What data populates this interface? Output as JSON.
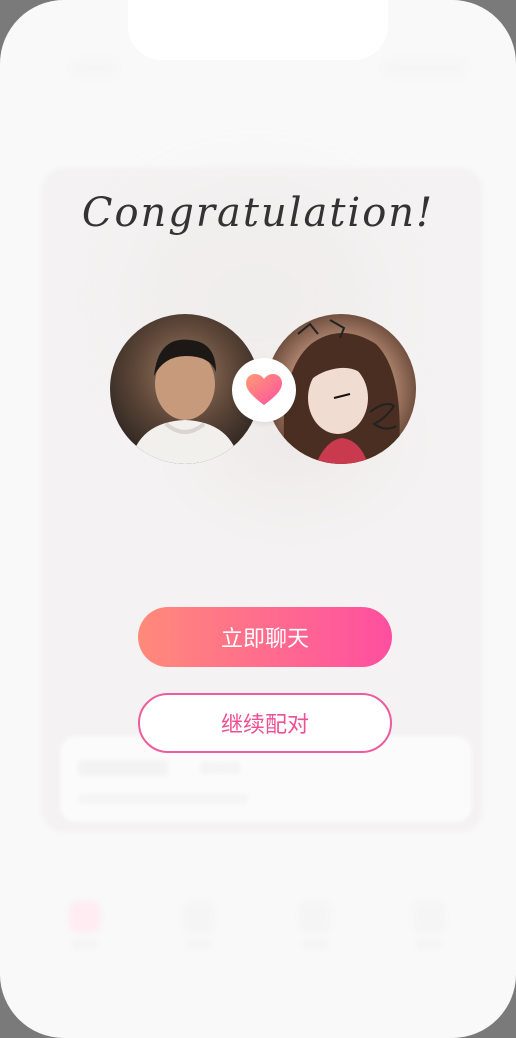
{
  "modal": {
    "title": "Congratulation!",
    "chat_button_label": "立即聊天",
    "continue_button_label": "继续配对"
  },
  "avatars": {
    "left_icon": "person-avatar",
    "right_icon": "person-avatar",
    "match_icon": "heart-icon"
  },
  "colors": {
    "accent_start": "#ff8a7a",
    "accent_end": "#ff4fa0",
    "outline": "#ef5c9e",
    "title_text": "#333333"
  }
}
